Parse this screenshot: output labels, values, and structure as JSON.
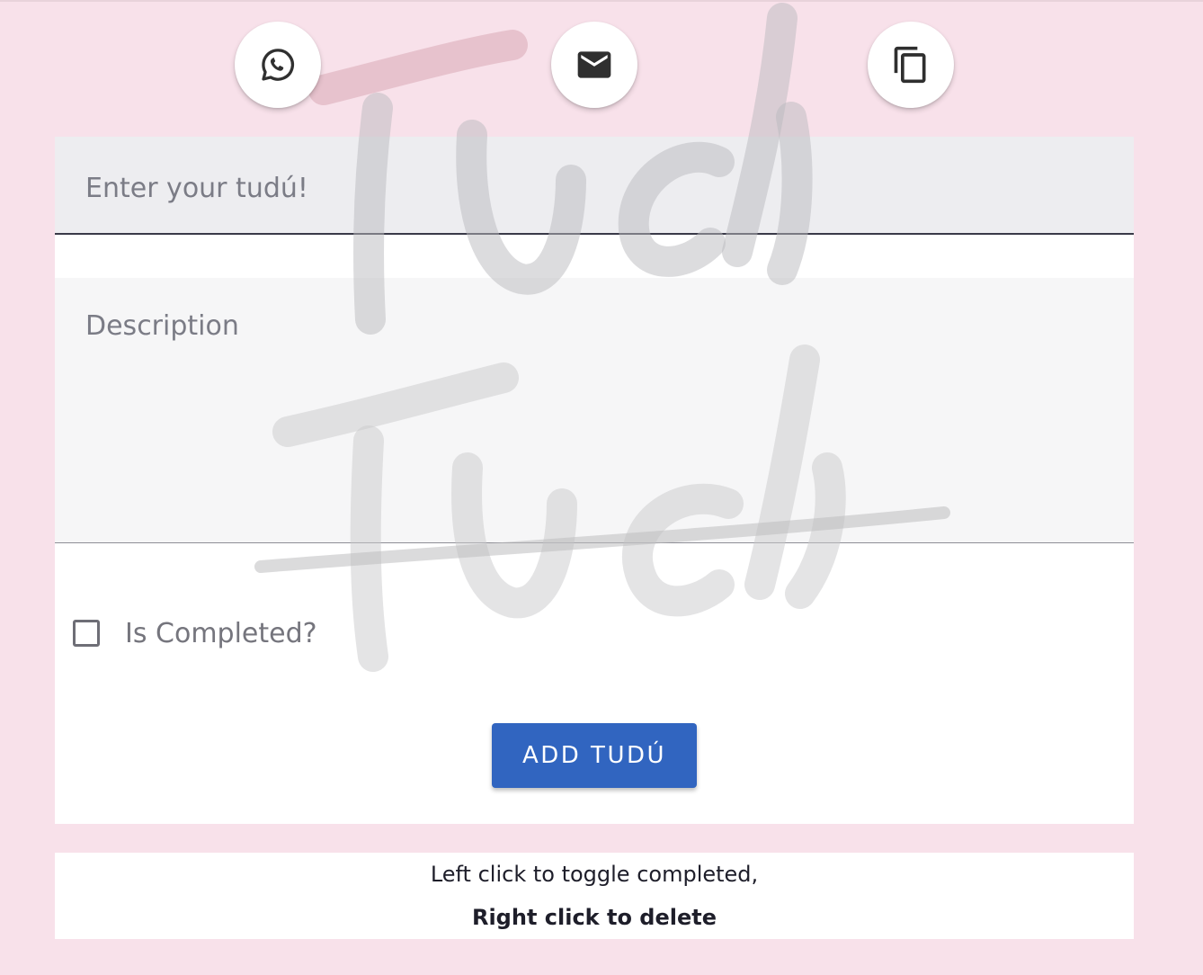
{
  "share": {
    "buttons": [
      {
        "icon": "whatsapp-icon"
      },
      {
        "icon": "email-icon"
      },
      {
        "icon": "copy-icon"
      }
    ]
  },
  "form": {
    "title_placeholder": "Enter your tudú!",
    "title_value": "",
    "description_placeholder": "Description",
    "description_value": "",
    "completed_label": "Is Completed?",
    "completed_checked": false,
    "add_button_label": "ADD TUDÚ"
  },
  "hint": {
    "line1": "Left click to toggle completed,",
    "line2": "Right click to delete"
  },
  "watermark": {
    "text": "Tudú"
  },
  "colors": {
    "background": "#f8e1ea",
    "accent": "#3165c0",
    "card": "#ffffff"
  }
}
